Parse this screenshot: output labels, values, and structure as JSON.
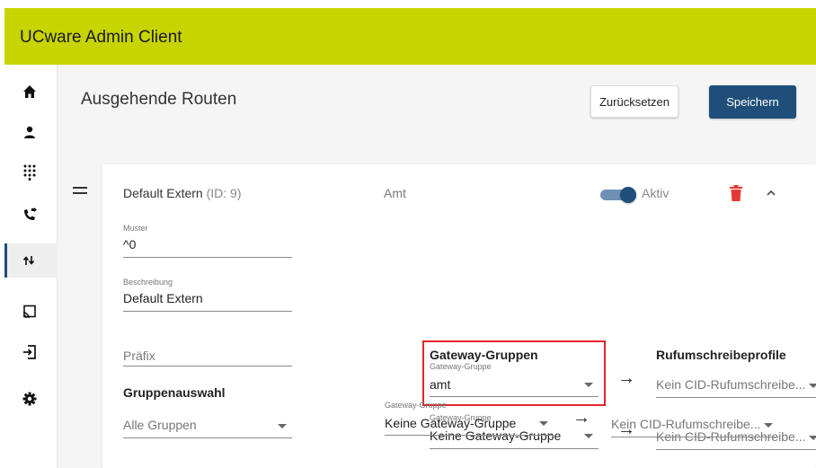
{
  "app": {
    "title": "UCware Admin Client"
  },
  "sidebar": {
    "items": [
      {
        "icon": "home-icon"
      },
      {
        "icon": "user-icon"
      },
      {
        "icon": "dialpad-icon"
      },
      {
        "icon": "phone-forward-icon"
      },
      {
        "icon": "outgoing-routes-icon",
        "active": true
      },
      {
        "icon": "cast-icon"
      },
      {
        "icon": "login-icon"
      },
      {
        "icon": "gear-icon"
      }
    ]
  },
  "header": {
    "page_title": "Ausgehende Routen",
    "reset_label": "Zurücksetzen",
    "save_label": "Speichern"
  },
  "route": {
    "name": "Default Extern",
    "id_text": "(ID: 9)",
    "type": "Amt",
    "toggle_label": "Aktiv",
    "muster_label": "Muster",
    "muster_value": "^0",
    "beschreibung_label": "Beschreibung",
    "beschreibung_value": "Default Extern",
    "praefix_placeholder": "Präfix",
    "gruppenauswahl_heading": "Gruppenauswahl",
    "gruppenauswahl_value": "Alle Gruppen",
    "gateway_heading": "Gateway-Gruppen",
    "cid_heading": "Rufumschreibeprofile",
    "gateway_rows": [
      {
        "label": "Gateway-Gruppe",
        "value": "amt",
        "cid": "Kein CID-Rufumschreibe..."
      },
      {
        "label": "Gateway-Gruppe",
        "value": "Keine Gateway-Gruppe",
        "cid": "Kein CID-Rufumschreibe..."
      },
      {
        "label": "Gateway-Gruppe",
        "value": "Keine Gateway-Gruppe",
        "cid": "Kein CID-Rufumschreibe..."
      }
    ],
    "arrow_glyph": "→"
  },
  "colors": {
    "appbar": "#c8d400",
    "primary": "#1e4e79",
    "delete": "#e53935",
    "highlight": "#e2232a"
  }
}
